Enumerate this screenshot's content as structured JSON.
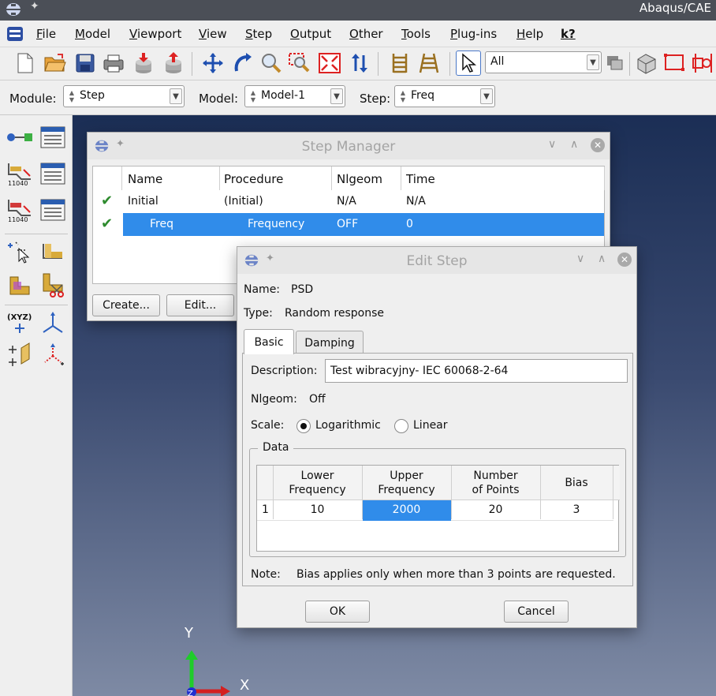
{
  "app": {
    "title": "Abaqus/CAE"
  },
  "menu": {
    "items": [
      "File",
      "Model",
      "Viewport",
      "View",
      "Step",
      "Output",
      "Other",
      "Tools",
      "Plug-ins",
      "Help"
    ],
    "whats_this": "k?"
  },
  "toolbar": {
    "selection_filter": "All"
  },
  "context": {
    "module_label": "Module:",
    "module_value": "Step",
    "model_label": "Model:",
    "model_value": "Model-1",
    "step_label": "Step:",
    "step_value": "Freq"
  },
  "step_manager": {
    "title": "Step Manager",
    "columns": [
      "Name",
      "Procedure",
      "Nlgeom",
      "Time"
    ],
    "rows": [
      {
        "name": "Initial",
        "procedure": "(Initial)",
        "nlgeom": "N/A",
        "time": "N/A",
        "selected": false
      },
      {
        "name": "Freq",
        "procedure": "Frequency",
        "nlgeom": "OFF",
        "time": "0",
        "selected": true
      }
    ],
    "create_label": "Create...",
    "edit_label": "Edit..."
  },
  "edit_step": {
    "title": "Edit Step",
    "name_label": "Name:",
    "name_value": "PSD",
    "type_label": "Type:",
    "type_value": "Random response",
    "tabs": [
      "Basic",
      "Damping"
    ],
    "description_label": "Description:",
    "description_value": "Test wibracyjny- IEC 60068-2-64",
    "nlgeom_label": "Nlgeom:",
    "nlgeom_value": "Off",
    "scale_label": "Scale:",
    "scale_log": "Logarithmic",
    "scale_linear": "Linear",
    "scale_selected": "Logarithmic",
    "data_group_label": "Data",
    "data_columns": [
      {
        "line1": "Lower",
        "line2": "Frequency"
      },
      {
        "line1": "Upper",
        "line2": "Frequency"
      },
      {
        "line1": "Number",
        "line2": "of Points"
      },
      {
        "line1": "Bias",
        "line2": ""
      }
    ],
    "data_rows": [
      {
        "index": "1",
        "lower": "10",
        "upper": "2000",
        "points": "20",
        "bias": "3"
      }
    ],
    "note_label": "Note:",
    "note_text": "Bias applies only when more than 3 points are requested.",
    "ok_label": "OK",
    "cancel_label": "Cancel"
  },
  "triad": {
    "y_label": "Y",
    "x_label": "X"
  },
  "colors": {
    "selection": "#308cea",
    "check": "#2e8b2e",
    "viewport_top": "#1b2e55",
    "viewport_bottom": "#7e8aa4"
  }
}
